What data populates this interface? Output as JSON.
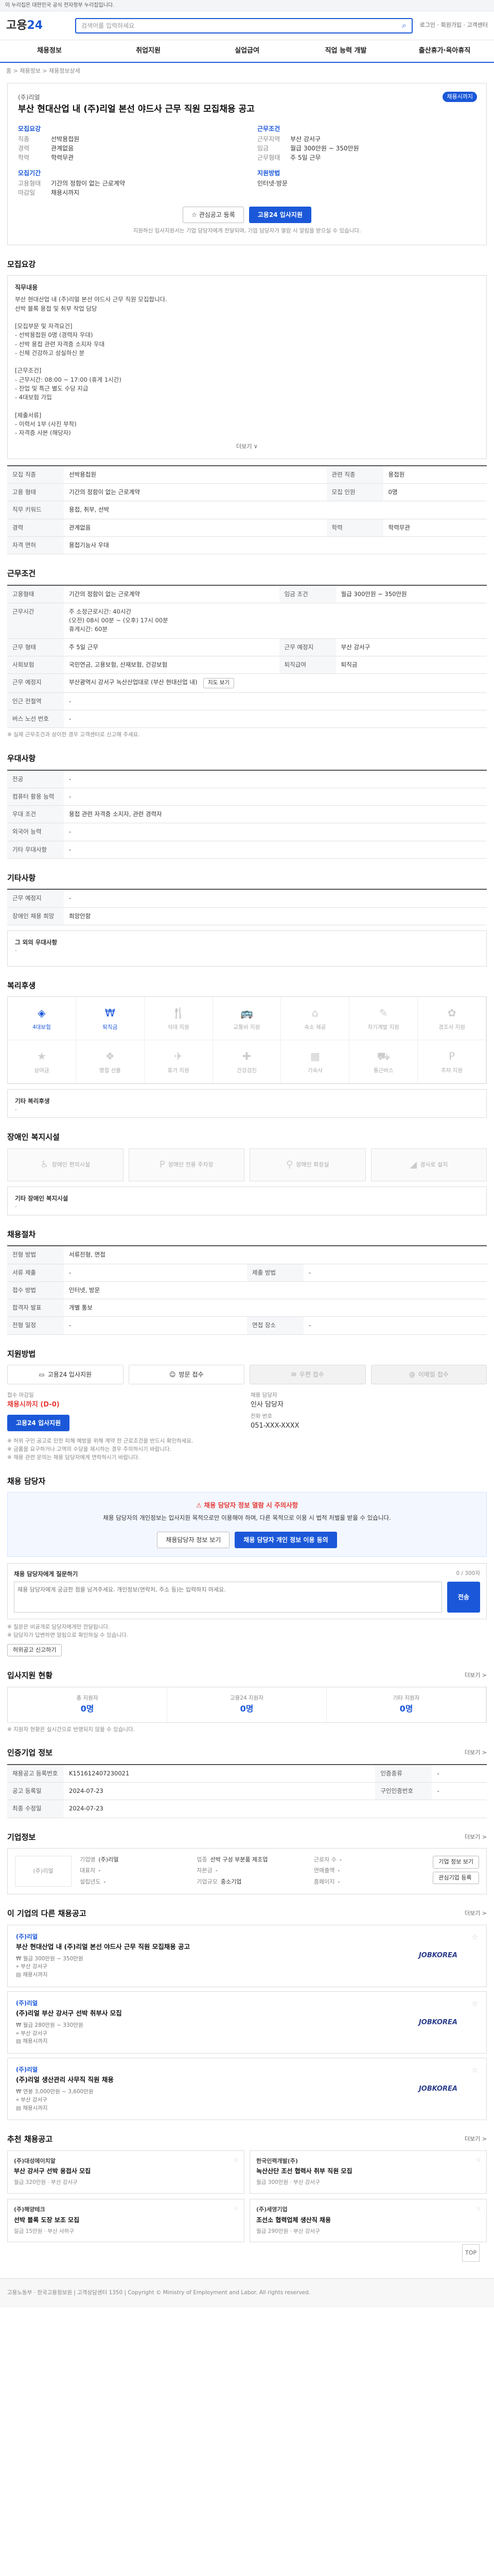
{
  "gov_banner": "이 누리집은 대한민국 공식 전자정부 누리집입니다.",
  "header": {
    "logo_main": "고용",
    "logo_sub": "24",
    "search_placeholder": "검색어를 입력하세요",
    "right_links": "로그인 · 회원가입 · 고객센터",
    "nav": [
      "채용정보",
      "취업지원",
      "실업급여",
      "직업 능력 개발",
      "출산휴가·육아휴직"
    ]
  },
  "breadcrumb": "홈 > 채용정보 > 채용정보상세",
  "post": {
    "company": "(주)리얼",
    "dday": "채용시까지",
    "title": "부산 현대산업 내 (주)리얼 본선 야드사 근무 직원 모집채용 공고",
    "labels": {
      "recruit": "모집요강",
      "conditions": "근무조건",
      "period": "모집기간",
      "apply": "지원방법"
    },
    "job": "직종",
    "job_value": "선박용접원",
    "career": "경력",
    "career_value": "관계없음",
    "edu": "학력",
    "edu_value": "학력무관",
    "area": "근무지역",
    "area_value": "부산 강서구",
    "wage": "임금",
    "wage_value": "월급 300만원 ~ 350만원",
    "form": "고용형태",
    "form_value": "기간의 정함이 없는 근로계약",
    "worktime": "근무형태",
    "worktime_value": "주 5일 근무",
    "deadline": "마감일",
    "deadline_value": "채용시까지",
    "apply_method": "인터넷·방문",
    "btn_interest": "관심공고 등록",
    "btn_apply": "고용24 입사지원",
    "note": "지원하신 입사지원서는 기업 담당자에게 전달되며, 기업 담당자가 열람 시 알림을 받으실 수 있습니다."
  },
  "recruit": {
    "title": "모집요강",
    "content_label": "직무내용",
    "content": "부산 현대산업 내 (주)리얼 본선 야드사 근무 직원 모집합니다.\n선박 블록 용접 및 취부 작업 담당\n\n[모집부문 및 자격요건]\n- 선박용접원 0명 (경력자 우대)\n- 선박 용접 관련 자격증 소지자 우대\n- 신체 건강하고 성실하신 분\n\n[근무조건]\n- 근무시간: 08:00 ~ 17:00 (휴게 1시간)\n- 잔업 및 특근 별도 수당 지급\n- 4대보험 가입\n\n[제출서류]\n- 이력서 1부 (사진 부착)\n- 자격증 사본 (해당자)",
    "more": "더보기 ∨",
    "rows": [
      {
        "k": "모집 직종",
        "v": "선박용접원",
        "k2": "관련 직종",
        "v2": "용접원"
      },
      {
        "k": "고용 형태",
        "v": "기간의 정함이 없는 근로계약",
        "k2": "모집 인원",
        "v2": "0명"
      },
      {
        "k": "직무 키워드",
        "v": "용접, 취부, 선박",
        "k2": "",
        "v2": ""
      },
      {
        "k": "경력",
        "v": "관계없음",
        "k2": "학력",
        "v2": "학력무관"
      },
      {
        "k": "자격 면허",
        "v": "용접기능사 우대",
        "k2": "",
        "v2": ""
      }
    ]
  },
  "conditions": {
    "title": "근무조건",
    "rows": [
      {
        "k": "고용형태",
        "v": "기간의 정함이 없는 근로계약",
        "k2": "임금 조건",
        "v2": "월급 300만원 ~ 350만원"
      },
      {
        "k": "근무시간",
        "v": "주 소정근로시간: 40시간\n(오전) 08시 00분 ~ (오후) 17시 00분\n휴게시간: 60분",
        "k2": "",
        "v2": ""
      },
      {
        "k": "근무 형태",
        "v": "주 5일 근무",
        "k2": "근무 예정지",
        "v2": "부산 강서구"
      },
      {
        "k": "사회보험",
        "v": "국민연금, 고용보험, 산재보험, 건강보험",
        "k2": "퇴직급여",
        "v2": "퇴직금"
      },
      {
        "k": "근무 예정지",
        "v": "부산광역시 강서구 녹산산업대로 (부산 현대산업 내)",
        "k2": "",
        "v2": ""
      },
      {
        "k": "인근 전철역",
        "v": "-",
        "k2": "",
        "v2": ""
      },
      {
        "k": "버스 노선 번호",
        "v": "-",
        "k2": "",
        "v2": ""
      }
    ],
    "map_btn": "지도 보기",
    "note": "※ 실제 근무조건과 상이한 경우 고객센터로 신고해 주세요."
  },
  "preference": {
    "title": "우대사항",
    "rows": [
      {
        "k": "전공",
        "v": "-"
      },
      {
        "k": "컴퓨터 활용 능력",
        "v": "-"
      },
      {
        "k": "우대 조건",
        "v": "용접 관련 자격증 소지자, 관련 경력자"
      },
      {
        "k": "외국어 능력",
        "v": "-"
      },
      {
        "k": "기타 우대사항",
        "v": "-"
      }
    ]
  },
  "etc": {
    "title": "기타사항",
    "rows": [
      {
        "k": "근무 예정지",
        "v": "-"
      },
      {
        "k": "장애인 채용 희망",
        "v": "희망안함"
      }
    ],
    "other_label": "그 외의 우대사항",
    "other_value": "-"
  },
  "welfare": {
    "title": "복리후생",
    "items": [
      {
        "label": "4대보험",
        "on": true
      },
      {
        "label": "퇴직금",
        "on": true
      },
      {
        "label": "식대 지원",
        "on": false
      },
      {
        "label": "교통비 지원",
        "on": false
      },
      {
        "label": "숙소 제공",
        "on": false
      },
      {
        "label": "자기계발 지원",
        "on": false
      },
      {
        "label": "경조사 지원",
        "on": false
      },
      {
        "label": "상여금",
        "on": false
      },
      {
        "label": "명절 선물",
        "on": false
      },
      {
        "label": "휴가 지원",
        "on": false
      },
      {
        "label": "건강검진",
        "on": false
      },
      {
        "label": "기숙사",
        "on": false
      },
      {
        "label": "통근버스",
        "on": false
      },
      {
        "label": "주차 지원",
        "on": false
      }
    ],
    "other_label": "기타 복리후생",
    "other_value": "-"
  },
  "disability": {
    "title": "장애인 복지시설",
    "items": [
      "장애인 편의시설",
      "장애인 전용 주차장",
      "장애인 화장실",
      "경사로 설치"
    ],
    "other_label": "기타 장애인 복지시설",
    "other_value": "-"
  },
  "process": {
    "title": "채용절차",
    "rows": [
      {
        "k": "전형 방법",
        "v": "서류전형, 면접",
        "k2": "",
        "v2": ""
      },
      {
        "k": "서류 제출",
        "v": "-",
        "k2": "제출 방법",
        "v2": "-"
      },
      {
        "k": "접수 방법",
        "v": "인터넷, 방문",
        "k2": "",
        "v2": ""
      },
      {
        "k": "합격자 발표",
        "v": "개별 통보",
        "k2": "",
        "v2": ""
      },
      {
        "k": "전형 일정",
        "v": "-",
        "k2": "면접 장소",
        "v2": "-"
      }
    ]
  },
  "apply": {
    "title": "지원방법",
    "methods": [
      {
        "label": "고용24 입사지원",
        "on": true
      },
      {
        "label": "방문 접수",
        "on": true
      },
      {
        "label": "우편 접수",
        "on": false
      },
      {
        "label": "이메일 접수",
        "on": false
      }
    ],
    "deadline_label": "접수 마감일",
    "deadline_value": "채용시까지 (D-0)",
    "manager_label": "채용 담당자",
    "manager_value": "인사 담당자",
    "phone_label": "전화 번호",
    "phone_value": "051-XXX-XXXX",
    "apply_btn": "고용24 입사지원",
    "notes": "※ 허위 구인 공고로 인한 피해 예방을 위해 계약 전 근로조건을 반드시 확인하세요.\n※ 금품을 요구하거나 고액의 수당을 제시하는 경우 주의하시기 바랍니다.\n※ 채용 관련 문의는 채용 담당자에게 연락하시기 바랍니다."
  },
  "qa": {
    "title": "채용 담당자",
    "callout_title": "채용 담당자 정보 열람 시 주의사항",
    "callout_text": "채용 담당자의 개인정보는 입사지원 목적으로만 이용해야 하며, 다른 목적으로 이용 시 법적 처벌을 받을 수 있습니다.",
    "callout_btn1": "채용담당자 정보 보기",
    "callout_btn2": "채용 담당자 개인 정보 이용 동의",
    "box_title": "채용 담당자에게 질문하기",
    "box_count": "0 / 300자",
    "placeholder": "채용 담당자에게 궁금한 점을 남겨주세요. 개인정보(연락처, 주소 등)는 입력하지 마세요.",
    "send": "전송",
    "notes": "※ 질문은 비공개로 담당자에게만 전달됩니다.\n※ 담당자가 답변하면 알림으로 확인하실 수 있습니다.",
    "report_btn": "허위공고 신고하기"
  },
  "stats": {
    "title": "입사지원 현황",
    "more": "더보기 >",
    "items": [
      {
        "label": "총 지원자",
        "value": "0명"
      },
      {
        "label": "고용24 지원자",
        "value": "0명"
      },
      {
        "label": "기타 지원자",
        "value": "0명"
      }
    ],
    "note": "※ 지원자 현황은 실시간으로 반영되지 않을 수 있습니다."
  },
  "info": {
    "title": "인증기업 정보",
    "more": "더보기 >",
    "rows": [
      {
        "k": "채용공고 등록번호",
        "v": "K151612407230021",
        "k2": "인증종류",
        "v2": "-"
      },
      {
        "k": "공고 등록일",
        "v": "2024-07-23",
        "k2": "구인인증번호",
        "v2": "-"
      },
      {
        "k": "최종 수정일",
        "v": "2024-07-23",
        "k2": "",
        "v2": ""
      }
    ]
  },
  "company": {
    "title": "기업정보",
    "more": "더보기 >",
    "logo": "(주)리얼",
    "rows": [
      {
        "k": "기업명",
        "v": "(주)리얼"
      },
      {
        "k": "업종",
        "v": "선박 구성 부분품 제조업"
      },
      {
        "k": "근로자 수",
        "v": "-"
      },
      {
        "k": "대표자",
        "v": "-"
      },
      {
        "k": "자본금",
        "v": "-"
      },
      {
        "k": "연매출액",
        "v": "-"
      },
      {
        "k": "설립년도",
        "v": "-"
      },
      {
        "k": "기업규모",
        "v": "중소기업"
      },
      {
        "k": "홈페이지",
        "v": "-"
      }
    ],
    "btn1": "기업 정보 보기",
    "btn2": "관심기업 등록"
  },
  "related": {
    "title": "이 기업의 다른 채용공고",
    "more": "더보기 >",
    "items": [
      {
        "company": "(주)리얼",
        "title": "부산 현대산업 내 (주)리얼 본선 야드사 근무 직원 모집채용 공고",
        "wage": "월급 300만원 ~ 350만원",
        "area": "부산 강서구",
        "deadline": "채용시까지"
      },
      {
        "company": "(주)리얼",
        "title": "(주)리얼 부산 강서구 선박 취부사 모집",
        "wage": "월급 280만원 ~ 330만원",
        "area": "부산 강서구",
        "deadline": "채용시까지"
      },
      {
        "company": "(주)리얼",
        "title": "(주)리얼 생산관리 사무직 직원 채용",
        "wage": "연봉 3,000만원 ~ 3,600만원",
        "area": "부산 강서구",
        "deadline": "채용시까지"
      }
    ],
    "jk_logo": "JOBKOREA"
  },
  "recommended": {
    "title": "추천 채용공고",
    "more": "더보기 >",
    "items": [
      {
        "company": "(주)대성에이치알",
        "title": "부산 강서구 선박 용접사 모집",
        "meta": "월급 320만원 · 부산 강서구"
      },
      {
        "company": "한국인력개발(주)",
        "title": "녹산산단 조선 협력사 취부 직원 모집",
        "meta": "월급 300만원 · 부산 강서구"
      },
      {
        "company": "(주)해양테크",
        "title": "선박 블록 도장 보조 모집",
        "meta": "일급 15만원 · 부산 사하구"
      },
      {
        "company": "(주)세영기업",
        "title": "조선소 협력업체 생산직 채용",
        "meta": "월급 290만원 · 부산 강서구"
      }
    ]
  },
  "top_btn": "TOP",
  "footer": "고용노동부 · 한국고용정보원 | 고객상담센터 1350 | Copyright © Ministry of Employment and Labor. All rights reserved."
}
